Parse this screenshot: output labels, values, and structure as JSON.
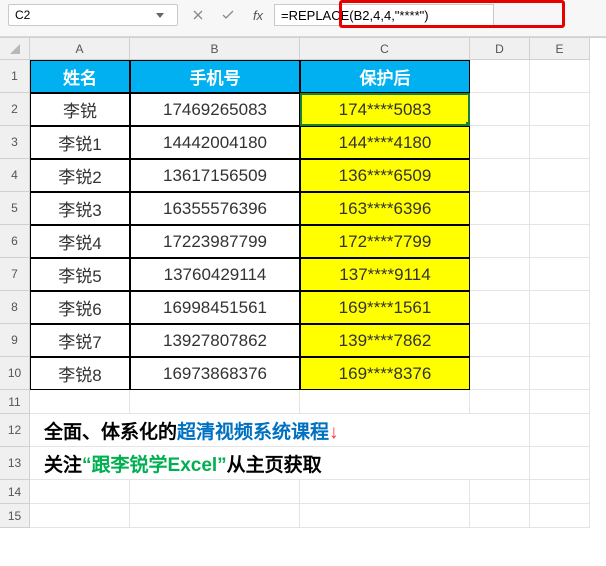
{
  "namebox": {
    "value": "C2"
  },
  "formula": {
    "value": "=REPLACE(B2,4,4,\"****\")"
  },
  "columns": [
    "A",
    "B",
    "C",
    "D",
    "E"
  ],
  "rowNumbers": [
    "1",
    "2",
    "3",
    "4",
    "5",
    "6",
    "7",
    "8",
    "9",
    "10",
    "11",
    "12",
    "13",
    "14",
    "15"
  ],
  "headers": {
    "A": "姓名",
    "B": "手机号",
    "C": "保护后"
  },
  "rows": [
    {
      "name": "李锐",
      "phone": "17469265083",
      "masked": "174****5083"
    },
    {
      "name": "李锐1",
      "phone": "14442004180",
      "masked": "144****4180"
    },
    {
      "name": "李锐2",
      "phone": "13617156509",
      "masked": "136****6509"
    },
    {
      "name": "李锐3",
      "phone": "16355576396",
      "masked": "163****6396"
    },
    {
      "name": "李锐4",
      "phone": "17223987799",
      "masked": "172****7799"
    },
    {
      "name": "李锐5",
      "phone": "13760429114",
      "masked": "137****9114"
    },
    {
      "name": "李锐6",
      "phone": "16998451561",
      "masked": "169****1561"
    },
    {
      "name": "李锐7",
      "phone": "13927807862",
      "masked": "139****7862"
    },
    {
      "name": "李锐8",
      "phone": "16973868376",
      "masked": "169****8376"
    }
  ],
  "promo": {
    "line1_a": "全面、体系化的",
    "line1_b": "超清视频系统课程",
    "line1_c": "↓",
    "line2_a": "关注",
    "line2_b": "“跟李锐学Excel”",
    "line2_c": "从主页获取"
  }
}
